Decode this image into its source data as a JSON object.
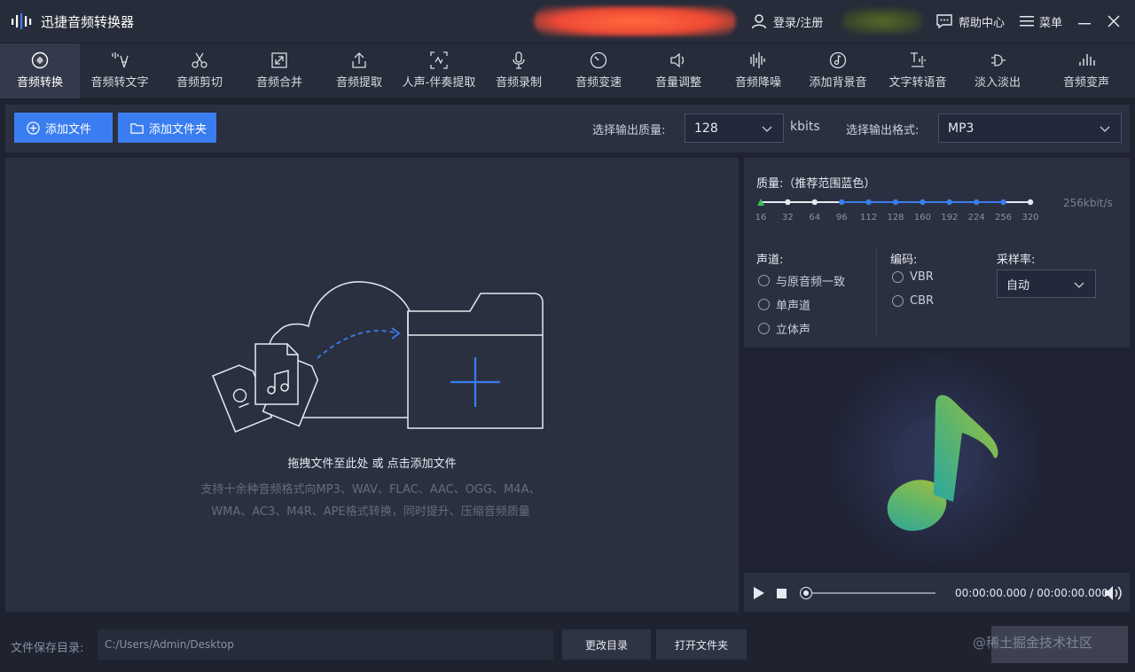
{
  "app": {
    "title": "迅捷音频转换器"
  },
  "titlebar": {
    "login_label": "登录/注册",
    "help_label": "帮助中心",
    "menu_label": "菜单"
  },
  "tools": [
    {
      "label": "音频转换",
      "icon": "waveform-icon",
      "active": true
    },
    {
      "label": "音频转文字",
      "icon": "voice-to-text-icon"
    },
    {
      "label": "音频剪切",
      "icon": "scissors-icon"
    },
    {
      "label": "音频合并",
      "icon": "merge-icon"
    },
    {
      "label": "音频提取",
      "icon": "upload-icon"
    },
    {
      "label": "人声-伴奏提取",
      "icon": "vocal-extract-icon"
    },
    {
      "label": "音频录制",
      "icon": "microphone-icon"
    },
    {
      "label": "音频变速",
      "icon": "speedometer-icon"
    },
    {
      "label": "音量调整",
      "icon": "volume-icon"
    },
    {
      "label": "音频降噪",
      "icon": "denoise-icon"
    },
    {
      "label": "添加背景音",
      "icon": "music-disc-icon"
    },
    {
      "label": "文字转语音",
      "icon": "text-to-speech-icon"
    },
    {
      "label": "淡入淡出",
      "icon": "fade-icon"
    },
    {
      "label": "音频变声",
      "icon": "voice-change-icon"
    }
  ],
  "actions": {
    "add_file": "添加文件",
    "add_folder": "添加文件夹",
    "quality_label": "选择输出质量:",
    "quality_value": "128",
    "quality_unit": "kbits",
    "format_label": "选择输出格式:",
    "format_value": "MP3"
  },
  "dropzone": {
    "main_text": "拖拽文件至此处 或 点击添加文件",
    "sub_text_1": "支持十余种音频格式向MP3、WAV、FLAC、AAC、OGG、M4A、",
    "sub_text_2": "WMA、AC3、M4R、APE格式转换，同时提升、压缩音频质量"
  },
  "settings": {
    "quality_title": "质量:（推荐范围蓝色）",
    "quality_ticks": [
      "16",
      "32",
      "64",
      "96",
      "112",
      "128",
      "160",
      "192",
      "224",
      "256",
      "320"
    ],
    "quality_max": "256kbit/s",
    "channel_title": "声道:",
    "channel_options": [
      "与原音频一致",
      "单声道",
      "立体声"
    ],
    "encoding_title": "编码:",
    "encoding_options": [
      "VBR",
      "CBR"
    ],
    "samplerate_title": "采样率:",
    "samplerate_value": "自动"
  },
  "player": {
    "time": "00:00:00.000 / 00:00:00.000"
  },
  "footer": {
    "save_dir_label": "文件保存目录:",
    "save_dir_value": "C:/Users/Admin/Desktop",
    "change_dir": "更改目录",
    "open_folder": "打开文件夹",
    "watermark": "@稀土掘金技术社区"
  },
  "colors": {
    "accent": "#3a7df0",
    "background": "#1f2330",
    "panel": "#2b3040"
  }
}
